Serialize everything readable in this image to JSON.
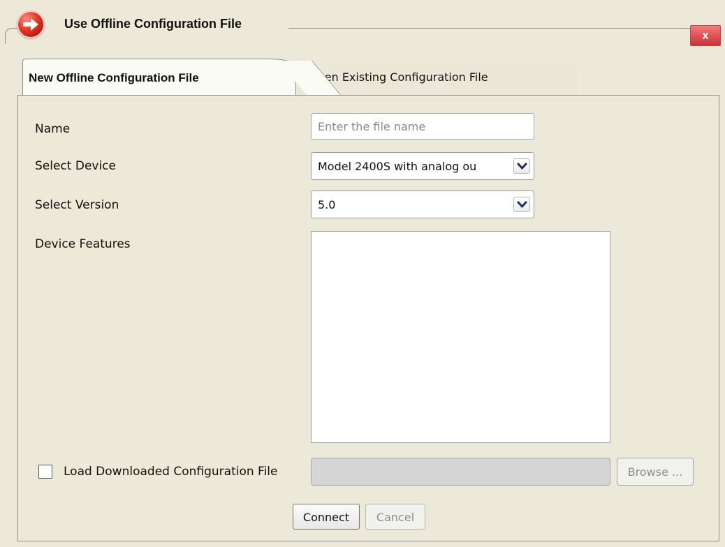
{
  "window": {
    "title": "Use Offline Configuration File",
    "close_label": "x"
  },
  "tabs": [
    {
      "label": "New Offline Configuration File",
      "selected": true
    },
    {
      "label": "Open Existing Configuration File",
      "selected": false
    }
  ],
  "form": {
    "name": {
      "label": "Name",
      "value": "",
      "placeholder": "Enter the file name"
    },
    "device": {
      "label": "Select Device",
      "value": "Model 2400S with analog ou"
    },
    "version": {
      "label": "Select Version",
      "value": "5.0"
    },
    "features": {
      "label": "Device Features",
      "items": []
    },
    "load_downloaded": {
      "label": "Load Downloaded Configuration File",
      "checked": false
    },
    "path": {
      "value": ""
    },
    "browse_label": "Browse ...",
    "connect_label": "Connect",
    "cancel_label": "Cancel"
  },
  "icons": {
    "title": "arrow-right-icon",
    "dropdown": "chevron-down-icon"
  },
  "colors": {
    "dialog_background": "#ece9d8",
    "close_button": "#e25759",
    "title_icon": "#d92f22",
    "disabled_input": "#d5d5d5"
  }
}
